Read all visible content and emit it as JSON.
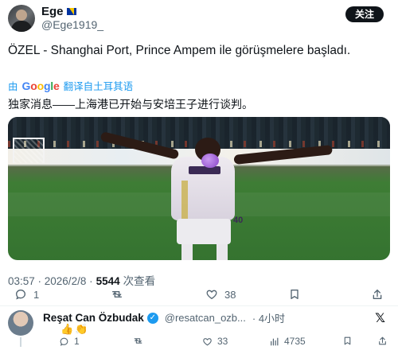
{
  "author": {
    "name": "Ege",
    "handle": "@Ege1919_",
    "follow_label": "关注"
  },
  "tweet": {
    "text": "ÖZEL - Shanghai Port, Prince Ampem ile görüşmelere başladı.",
    "translate_prefix": "由",
    "translate_brand": "Google",
    "translate_label": "翻译自土耳其语",
    "translated_text": "独家消息——上海港已开始与安培王子进行谈判。",
    "shorts_number": "40",
    "time": "03:57 · 2026/2/8 ·",
    "views": "5544",
    "views_label": "次查看"
  },
  "actions": {
    "reply_count": "1",
    "retweet_count": "",
    "like_count": "38",
    "bookmark_count": ""
  },
  "reply": {
    "name": "Reşat Can Özbudak",
    "handle": "@resatcan_ozb...",
    "time": "· 4小时",
    "emoji": "👍👏",
    "reply_count": "1",
    "like_count": "33",
    "views": "4735"
  },
  "colors": {
    "accent": "#1d9bf0",
    "text": "#0f1419",
    "muted": "#536471"
  }
}
